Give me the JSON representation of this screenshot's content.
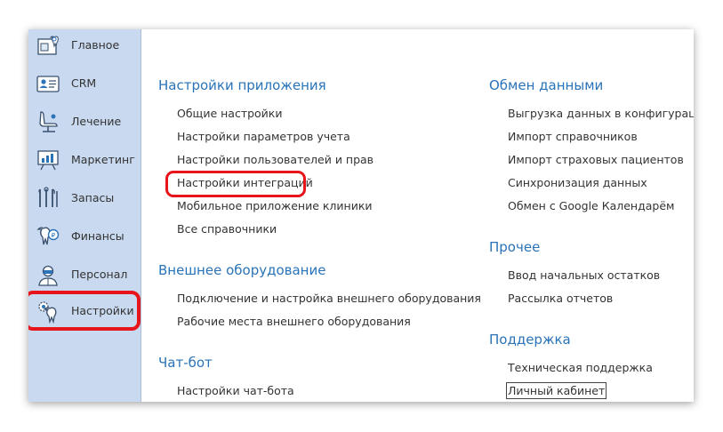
{
  "sidebar": {
    "items": [
      {
        "label": "Главное",
        "icon": "home-tooth-icon"
      },
      {
        "label": "CRM",
        "icon": "contact-card-icon"
      },
      {
        "label": "Лечение",
        "icon": "dental-chair-icon"
      },
      {
        "label": "Маркетинг",
        "icon": "presentation-chart-icon"
      },
      {
        "label": "Запасы",
        "icon": "dental-tools-icon"
      },
      {
        "label": "Финансы",
        "icon": "tooth-coin-icon"
      },
      {
        "label": "Персонал",
        "icon": "doctor-icon"
      },
      {
        "label": "Настройки",
        "icon": "tooth-gear-icon"
      }
    ],
    "active": "Настройки"
  },
  "sections": {
    "app_settings": {
      "title": "Настройки приложения",
      "links": [
        "Общие настройки",
        "Настройки параметров учета",
        "Настройки пользователей и прав",
        "Настройки интеграций",
        "Мобильное приложение клиники",
        "Все справочники"
      ]
    },
    "external_hw": {
      "title": "Внешнее оборудование",
      "links": [
        "Подключение и настройка внешнего оборудования",
        "Рабочие места внешнего оборудования"
      ]
    },
    "chatbot": {
      "title": "Чат-бот",
      "links": [
        "Настройки чат-бота"
      ]
    },
    "data_exchange": {
      "title": "Обмен данными",
      "links": [
        "Выгрузка данных в конфигурацию",
        "Импорт справочников",
        "Импорт страховых пациентов",
        "Синхронизация данных",
        "Обмен с Google Календарём"
      ]
    },
    "other": {
      "title": "Прочее",
      "links": [
        "Ввод начальных остатков",
        "Рассылка отчетов"
      ]
    },
    "support": {
      "title": "Поддержка",
      "links": [
        "Техническая поддержка",
        "Личный кабинет"
      ]
    }
  },
  "colors": {
    "sidebar_bg": "#c9d9ef",
    "section_title": "#2a73b8",
    "highlight": "#e8141b"
  }
}
